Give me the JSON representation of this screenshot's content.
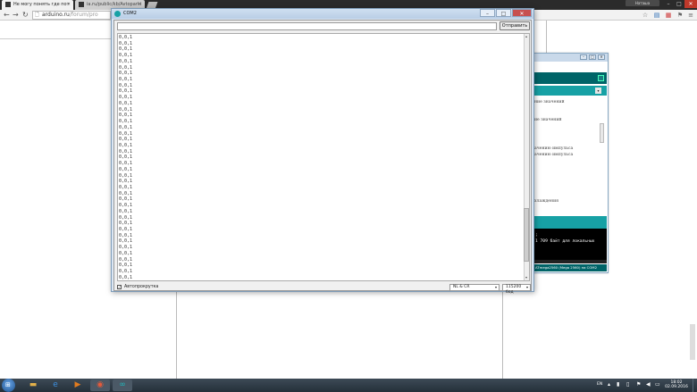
{
  "browser": {
    "tabs": [
      {
        "label": "Не могу понять где пот",
        "active": true
      },
      {
        "label": "ia.ru/public/kb/Avtoparki",
        "active": false
      }
    ],
    "user_badge": "Наташа",
    "address": {
      "domain": "arduino.ru",
      "path": "/forum/pro"
    }
  },
  "serial_monitor": {
    "title": "COM2",
    "input_value": "",
    "send_label": "Отправить",
    "lines": [
      "0,0,1",
      "0,0,1",
      "0,0,1",
      "0,0,1",
      "0,0,1",
      "0,0,1",
      "0,0,1",
      "0,0,1",
      "0,0,1",
      "0,0,1",
      "0,0,1",
      "0,0,1",
      "0,0,1",
      "0,0,1",
      "0,0,1",
      "0,0,1",
      "0,0,1",
      "0,0,1",
      "0,0,1",
      "0,0,1",
      "0,0,1",
      "0,0,1",
      "0,0,1",
      "0,0,1",
      "0,0,1",
      "0,0,1",
      "0,0,1",
      "0,0,1",
      "0,0,1",
      "0,0,1",
      "0,0,1",
      "0,0,1",
      "0,0,1",
      "0,0,1",
      "0,0,1",
      "0,0,1",
      "0,0,1",
      "0,0,1",
      "0,0,1",
      "0,0,1",
      "0,0,1"
    ],
    "autoscroll_label": "Автопрокрутка",
    "autoscroll_checked": true,
    "line_ending": "NL & CR",
    "baud_rate": "115200 бод"
  },
  "ide": {
    "code_lines": [
      "ние значений",
      "",
      "",
      "ие значений",
      "",
      "",
      "",
      "",
      "ачению импульса",
      "ачению импульса",
      "",
      "",
      "",
      "",
      "",
      "",
      "",
      "хлаждения"
    ],
    "console_lines": [
      ";",
      "1 709 байт для локальных"
    ],
    "status": "ATmega2560 (Mega 2560) на COM2"
  },
  "taskbar": {
    "apps": [
      {
        "icon": "file-explorer-icon",
        "color": "#d9a441"
      },
      {
        "icon": "internet-explorer-icon",
        "color": "#2f7fd1"
      },
      {
        "icon": "media-player-icon",
        "color": "#e07b1f"
      },
      {
        "icon": "chrome-icon",
        "color": "#dd4b39"
      },
      {
        "icon": "arduino-icon",
        "color": "#17a1a5"
      }
    ],
    "language": "EN",
    "time": "18:02",
    "date": "02.09.2016"
  }
}
